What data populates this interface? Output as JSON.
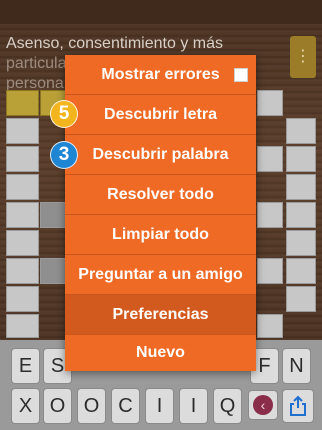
{
  "clue": {
    "line1": "Asenso, consentimiento y más",
    "line2": "particula",
    "line3": "persona"
  },
  "menu": {
    "items": [
      {
        "label": "Mostrar errores"
      },
      {
        "label": "Descubrir letra"
      },
      {
        "label": "Descubrir palabra"
      },
      {
        "label": "Resolver todo"
      },
      {
        "label": "Limpiar todo"
      },
      {
        "label": "Preguntar a un amigo"
      },
      {
        "label": "Preferencias"
      },
      {
        "label": "Nuevo"
      }
    ],
    "letter_hint_count": "5",
    "word_hint_count": "3"
  },
  "keyboard": {
    "row1": [
      "E",
      "S",
      "F",
      "N"
    ],
    "row2": [
      "X",
      "O",
      "O",
      "C",
      "I",
      "I",
      "Q"
    ]
  },
  "icons": {
    "menu": "kebab-icon",
    "backspace": "backspace-icon",
    "share": "share-icon"
  },
  "colors": {
    "menu_bg": "#ee6a25",
    "menu_dark_item": "#d35a1f",
    "badge_letter": "#f2b51d",
    "badge_word": "#1f86d4",
    "backspace": "#8a2d4a"
  }
}
